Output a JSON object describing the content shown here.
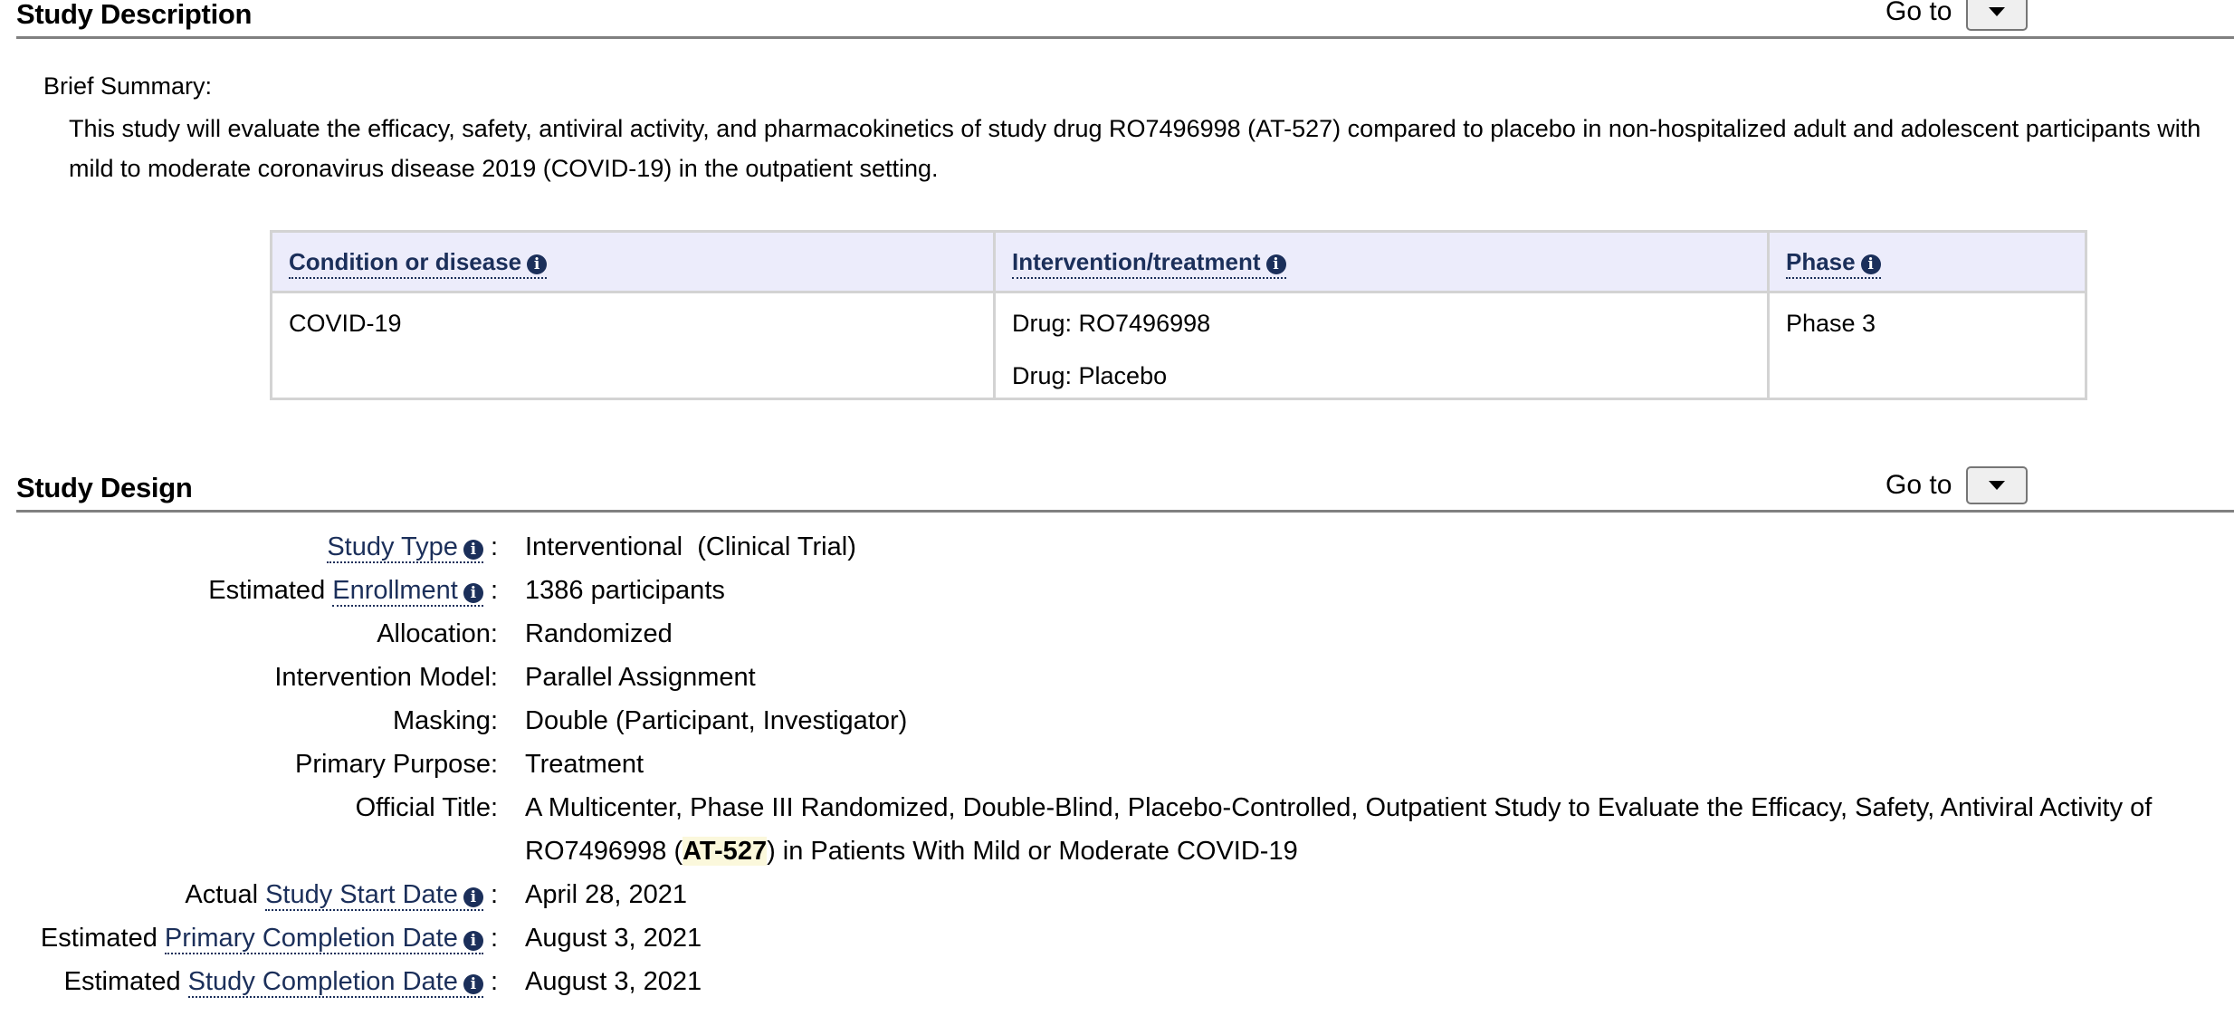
{
  "study_description": {
    "title": "Study Description",
    "goto_label": "Go to",
    "brief_summary_label": "Brief Summary:",
    "brief_summary_line1": "This study will evaluate the efficacy, safety, antiviral activity, and pharmacokinetics of study drug RO7496998 (AT-527) compared to placebo in non-hospitalized adult and adolescent participants with",
    "brief_summary_line2": "mild to moderate coronavirus disease 2019 (COVID-19) in the outpatient setting.",
    "table": {
      "headers": [
        "Condition or disease",
        "Intervention/treatment",
        "Phase"
      ],
      "condition": "COVID-19",
      "interventions": [
        "Drug: RO7496998",
        "Drug: Placebo"
      ],
      "phase": "Phase 3"
    }
  },
  "study_design": {
    "title": "Study Design",
    "goto_label": "Go to",
    "rows": [
      {
        "prefix": "",
        "link": "Study Type",
        "sep": ":",
        "value": "Interventional  (Clinical Trial)"
      },
      {
        "prefix": "Estimated ",
        "link": "Enrollment",
        "sep": ":",
        "value": "1386 participants"
      },
      {
        "label": "Allocation:",
        "value": "Randomized"
      },
      {
        "label": "Intervention Model:",
        "value": "Parallel Assignment"
      },
      {
        "label": "Masking:",
        "value": "Double (Participant, Investigator)"
      },
      {
        "label": "Primary Purpose:",
        "value": "Treatment"
      },
      {
        "label": "Official Title:",
        "value_line1": "A Multicenter, Phase III Randomized, Double-Blind, Placebo-Controlled, Outpatient Study to Evaluate the Efficacy, Safety, Antiviral Activity of",
        "value_line2_pre": "RO7496998 (",
        "value_line2_hl": "AT-527",
        "value_line2_post": ") in Patients With Mild or Moderate COVID-19"
      },
      {
        "prefix": "Actual ",
        "link": "Study Start Date",
        "sep": ":",
        "value": "April 28, 2021"
      },
      {
        "prefix": "Estimated ",
        "link": "Primary Completion Date",
        "sep": ":",
        "value": "August 3, 2021"
      },
      {
        "prefix": "Estimated ",
        "link": "Study Completion Date",
        "sep": ":",
        "value": "August 3, 2021"
      }
    ]
  },
  "icons": {
    "info": "i",
    "dropdown": "caret-down"
  },
  "colors": {
    "link": "#1b2f5a",
    "table_header_bg": "#ececfb",
    "highlight": "#fbf8dc",
    "rule": "#808080"
  }
}
